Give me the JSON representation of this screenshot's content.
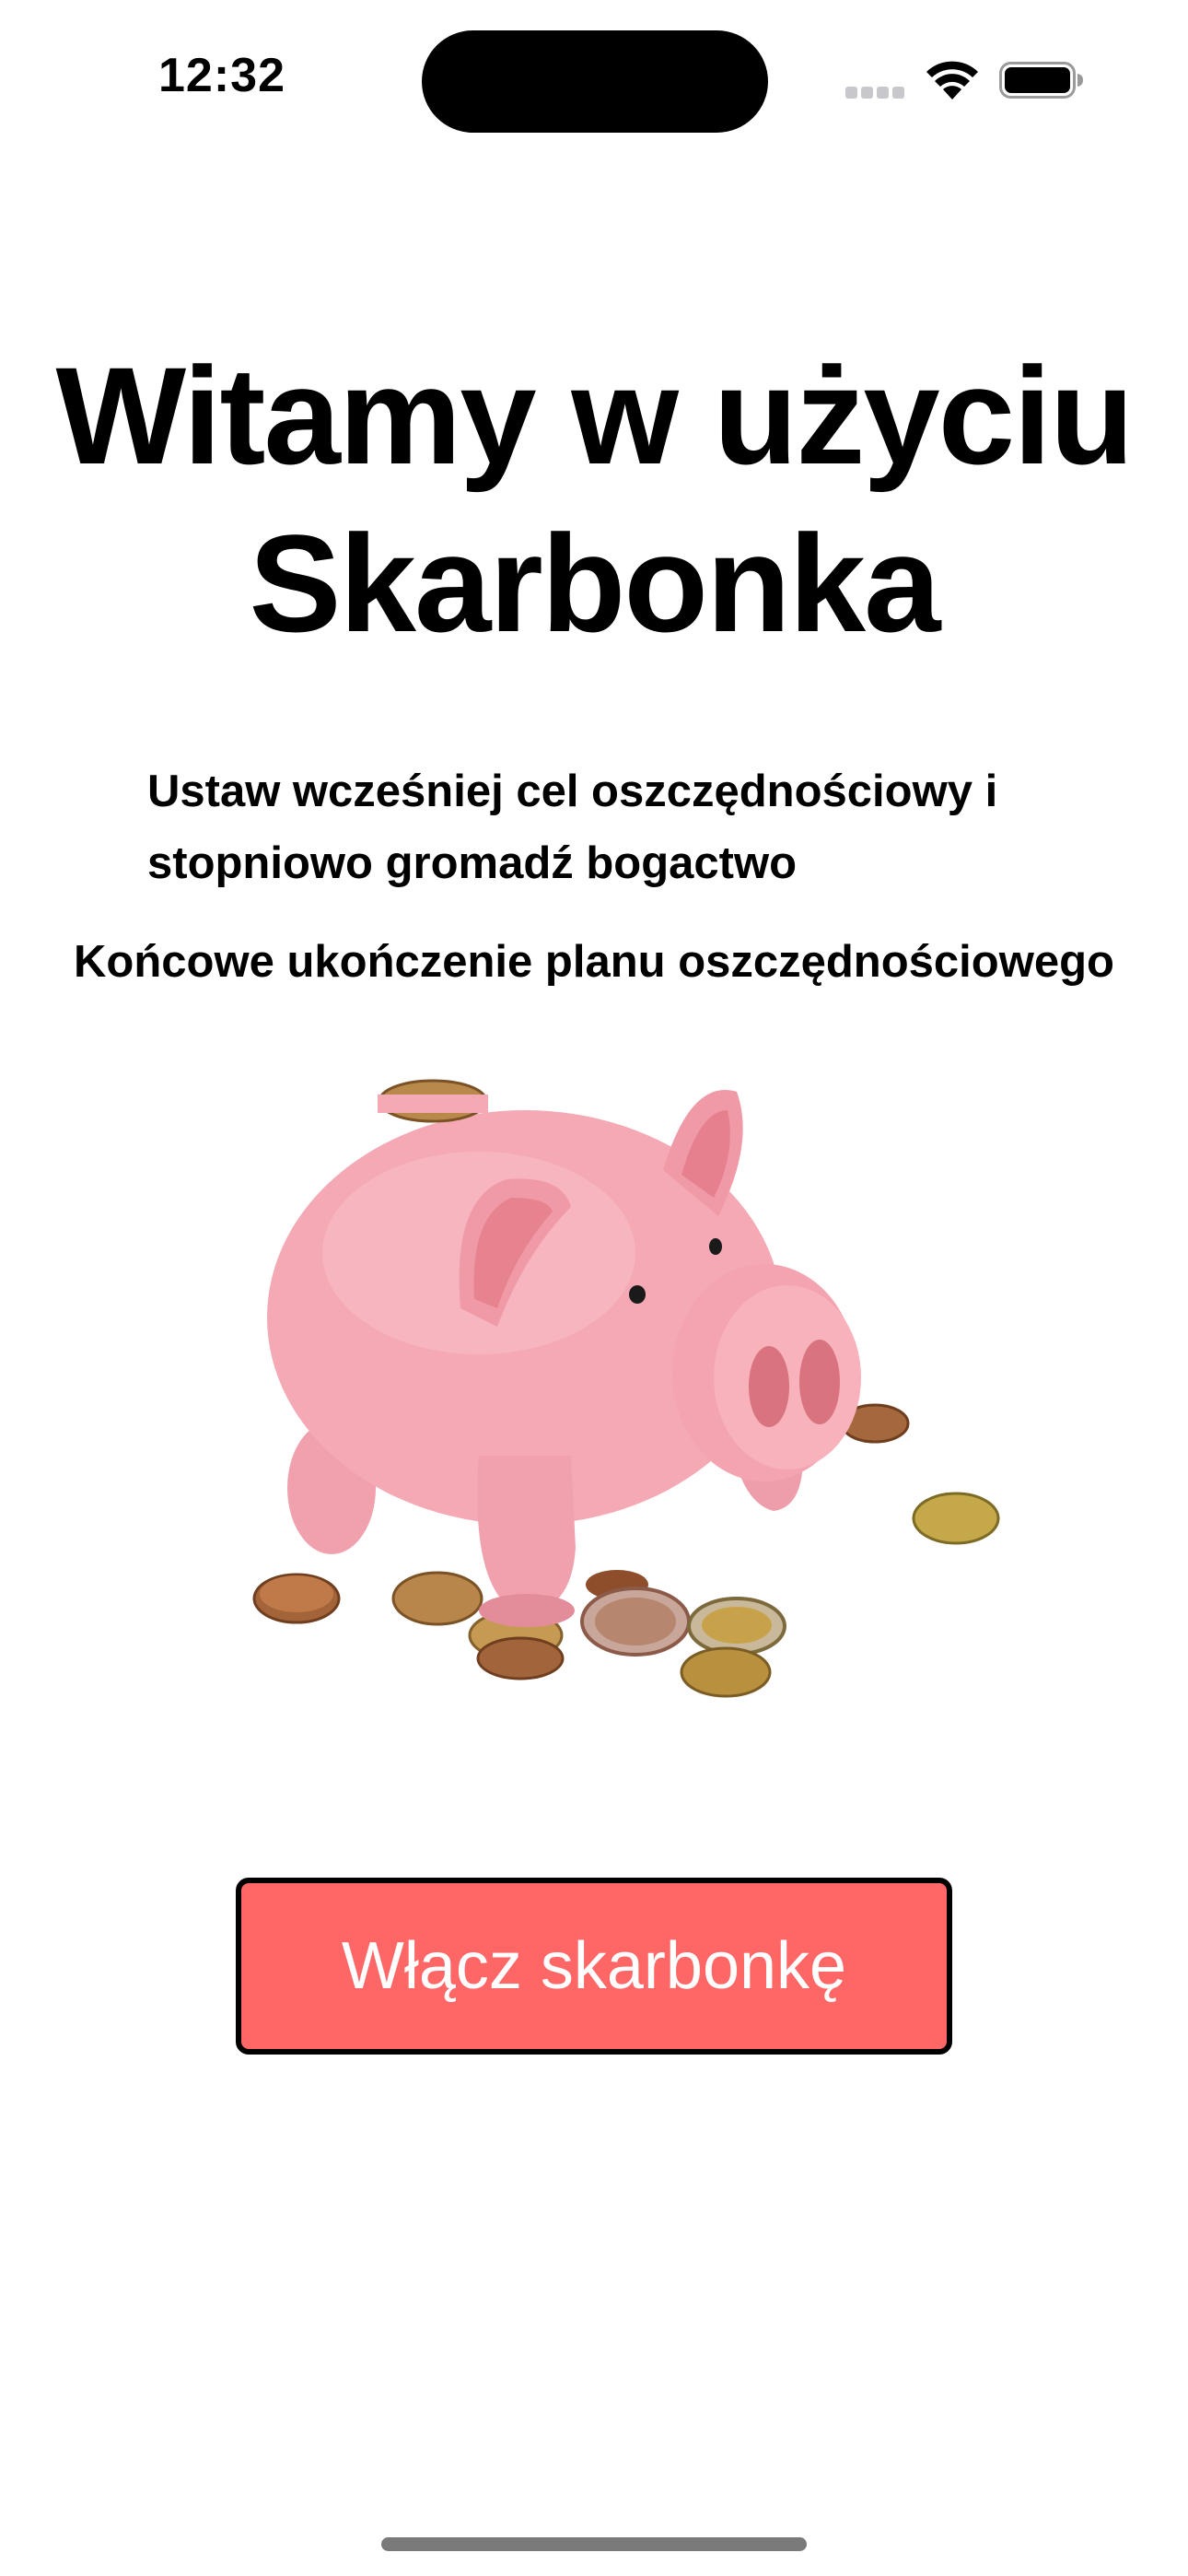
{
  "status_bar": {
    "time": "12:32"
  },
  "main": {
    "title": "Witamy w użyciu Skarbonka",
    "subtitle": "Ustaw wcześniej cel oszczędnościowy i stopniowo gromadź bogactwo",
    "subtitle_2": "Końcowe ukończenie planu oszczędnościowego",
    "cta_label": "Włącz skarbonkę"
  },
  "colors": {
    "button_bg": "#ff6666",
    "button_text": "#ffffff",
    "piggy_pink": "#f4a9b4"
  },
  "icons": [
    "cellular-signal-icon",
    "wifi-icon",
    "battery-icon",
    "piggy-bank-illustration"
  ]
}
